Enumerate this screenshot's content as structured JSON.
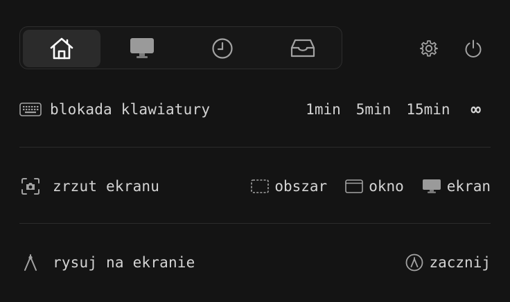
{
  "tabs": [
    {
      "icon": "home-icon",
      "active": true
    },
    {
      "icon": "monitor-icon",
      "active": false
    },
    {
      "icon": "clock-icon",
      "active": false
    },
    {
      "icon": "inbox-tray-icon",
      "active": false
    }
  ],
  "top_actions": [
    {
      "icon": "gear-icon"
    },
    {
      "icon": "power-icon"
    }
  ],
  "keyboard_lock": {
    "icon": "keyboard-icon",
    "label": "blokada klawiatury",
    "durations": [
      "1min",
      "5min",
      "15min",
      "∞"
    ]
  },
  "screenshot": {
    "icon": "camera-icon",
    "label": "zrzut ekranu",
    "options": [
      {
        "icon": "dashed-rect-icon",
        "label": "obszar"
      },
      {
        "icon": "window-icon",
        "label": "okno"
      },
      {
        "icon": "monitor-icon",
        "label": "ekran"
      }
    ]
  },
  "draw": {
    "icon": "compass-icon",
    "label": "rysuj na ekranie",
    "start_icon": "compass-circle-icon",
    "start_label": "zacznij"
  },
  "colors": {
    "background": "#141414",
    "text": "#d4d4d4",
    "active_tab": "#2b2b2b",
    "divider": "#2c2c2c"
  }
}
